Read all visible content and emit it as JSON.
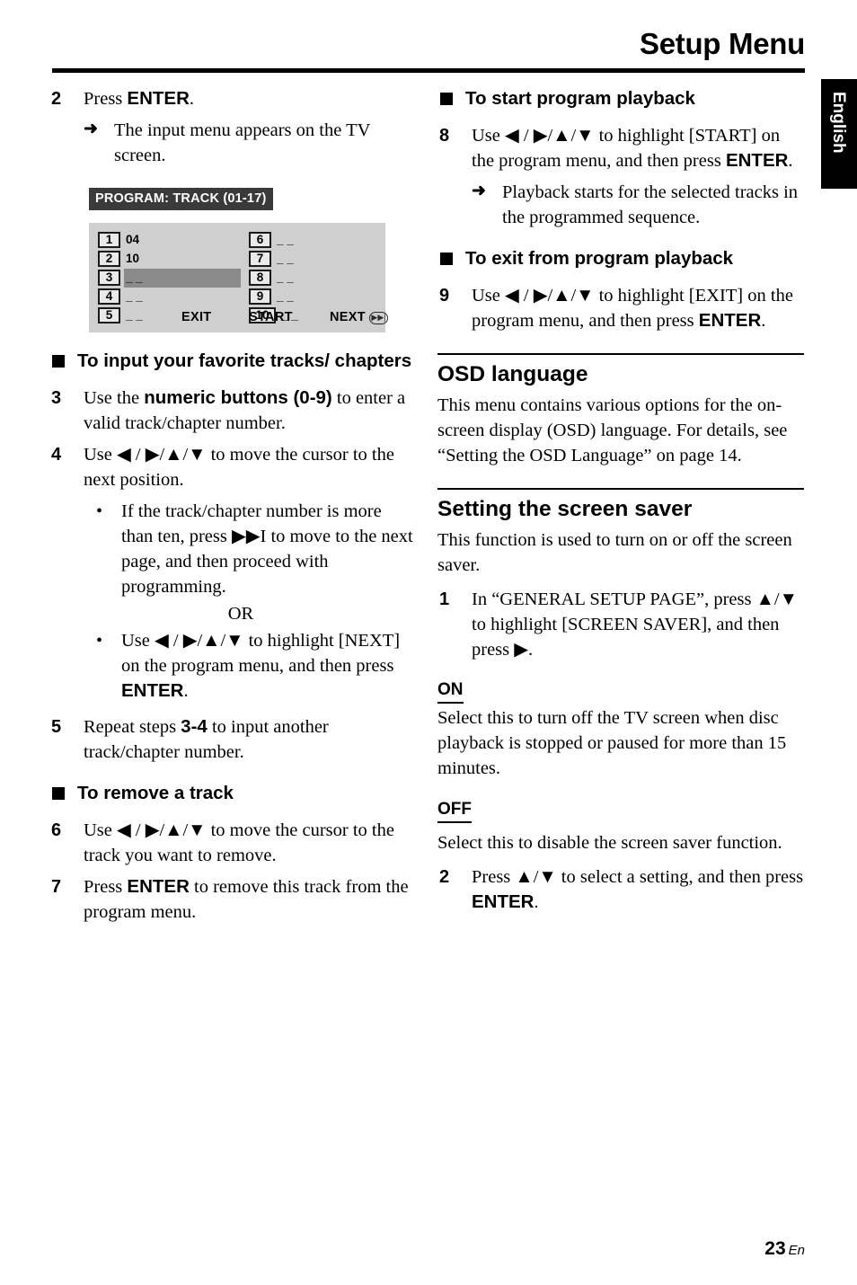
{
  "header": {
    "title": "Setup Menu"
  },
  "language_tab": {
    "label": "English"
  },
  "footer": {
    "page_number": "23",
    "lang_suffix": "En"
  },
  "left_column": {
    "step2": {
      "number": "2",
      "text_prefix": "Press ",
      "text_bold": "ENTER",
      "text_suffix": "."
    },
    "step2_result": {
      "arrow": "➜",
      "text": "The input menu appears on the TV screen."
    },
    "figure": {
      "badge": "PROGRAM: TRACK (01-17)",
      "rows_left": [
        {
          "index": "1",
          "value": "04",
          "selected": false
        },
        {
          "index": "2",
          "value": "10",
          "selected": false
        },
        {
          "index": "3",
          "value": "_ _",
          "selected": true
        },
        {
          "index": "4",
          "value": "_ _",
          "selected": false
        },
        {
          "index": "5",
          "value": "_ _",
          "selected": false
        }
      ],
      "rows_right": [
        {
          "index": "6",
          "value": "_ _",
          "selected": false
        },
        {
          "index": "7",
          "value": "_ _",
          "selected": false
        },
        {
          "index": "8",
          "value": "_ _",
          "selected": false
        },
        {
          "index": "9",
          "value": "_ _",
          "selected": false
        },
        {
          "index": "10",
          "value": "_ _",
          "selected": false
        }
      ],
      "buttons": {
        "exit": "EXIT",
        "start": "START",
        "next": "NEXT",
        "next_icon": "▶▶|"
      }
    },
    "heading_input_tracks": "To input your favorite tracks/ chapters",
    "step3": {
      "number": "3",
      "part1": "Use the ",
      "bold": "numeric buttons (0-9)",
      "part2": " to enter a valid track/chapter number."
    },
    "step4": {
      "number": "4",
      "text": "Use ◀ / ▶/▲/▼ to move the cursor to the next position."
    },
    "step4_bullet1": {
      "bullet": "•",
      "text": "If the track/chapter number is more than ten, press ▶▶I to move to the next page, and then proceed with programming."
    },
    "or": "OR",
    "step4_bullet2": {
      "bullet": "•",
      "part1": "Use ◀ / ▶/▲/▼ to highlight [NEXT] on the program menu, and then press ",
      "bold": "ENTER",
      "part2": "."
    },
    "step5": {
      "number": "5",
      "part1": "Repeat steps ",
      "bold": "3-4",
      "part2": " to input another track/chapter number."
    },
    "heading_remove_track": "To remove a track",
    "step6": {
      "number": "6",
      "text": "Use ◀ / ▶/▲/▼ to move the cursor to the track you want to remove."
    },
    "step7": {
      "number": "7",
      "part1": "Press ",
      "bold": "ENTER",
      "part2": " to remove this track from the program menu."
    }
  },
  "right_column": {
    "heading_start_playback": "To start program playback",
    "step8": {
      "number": "8",
      "part1": "Use ◀ / ▶/▲/▼ to highlight [START] on the program menu, and then press ",
      "bold": "ENTER",
      "part2": "."
    },
    "step8_result": {
      "arrow": "➜",
      "text": "Playback starts for the selected tracks in the programmed sequence."
    },
    "heading_exit_playback": "To exit from program playback",
    "step9": {
      "number": "9",
      "part1": "Use ◀ / ▶/▲/▼ to highlight [EXIT] on the program menu, and then press ",
      "bold": "ENTER",
      "part2": "."
    },
    "osd_section": {
      "heading": "OSD language",
      "body": "This menu contains various options for the on-screen display (OSD) language. For details, see “Setting the OSD Language” on page 14."
    },
    "screen_saver_section": {
      "heading": "Setting the screen saver",
      "body": "This function is used to turn on or off the screen saver.",
      "step1": {
        "number": "1",
        "text": "In “GENERAL SETUP PAGE”, press ▲/▼ to highlight [SCREEN SAVER], and then press ▶."
      },
      "option_on": {
        "label": "ON",
        "description": "Select this to turn off the TV screen when disc playback is stopped or paused for more than 15 minutes."
      },
      "option_off": {
        "label": "OFF",
        "description": "Select this to disable the screen saver function."
      },
      "step2": {
        "number": "2",
        "part1": "Press ▲/▼ to select a setting, and then press ",
        "bold": "ENTER",
        "part2": "."
      }
    }
  },
  "colors": {
    "figure_screen_bg": "#cfcfcf",
    "figure_badge_bg": "#3a3a3a",
    "figure_highlight": "#8a8a8a",
    "rule": "#000000"
  }
}
